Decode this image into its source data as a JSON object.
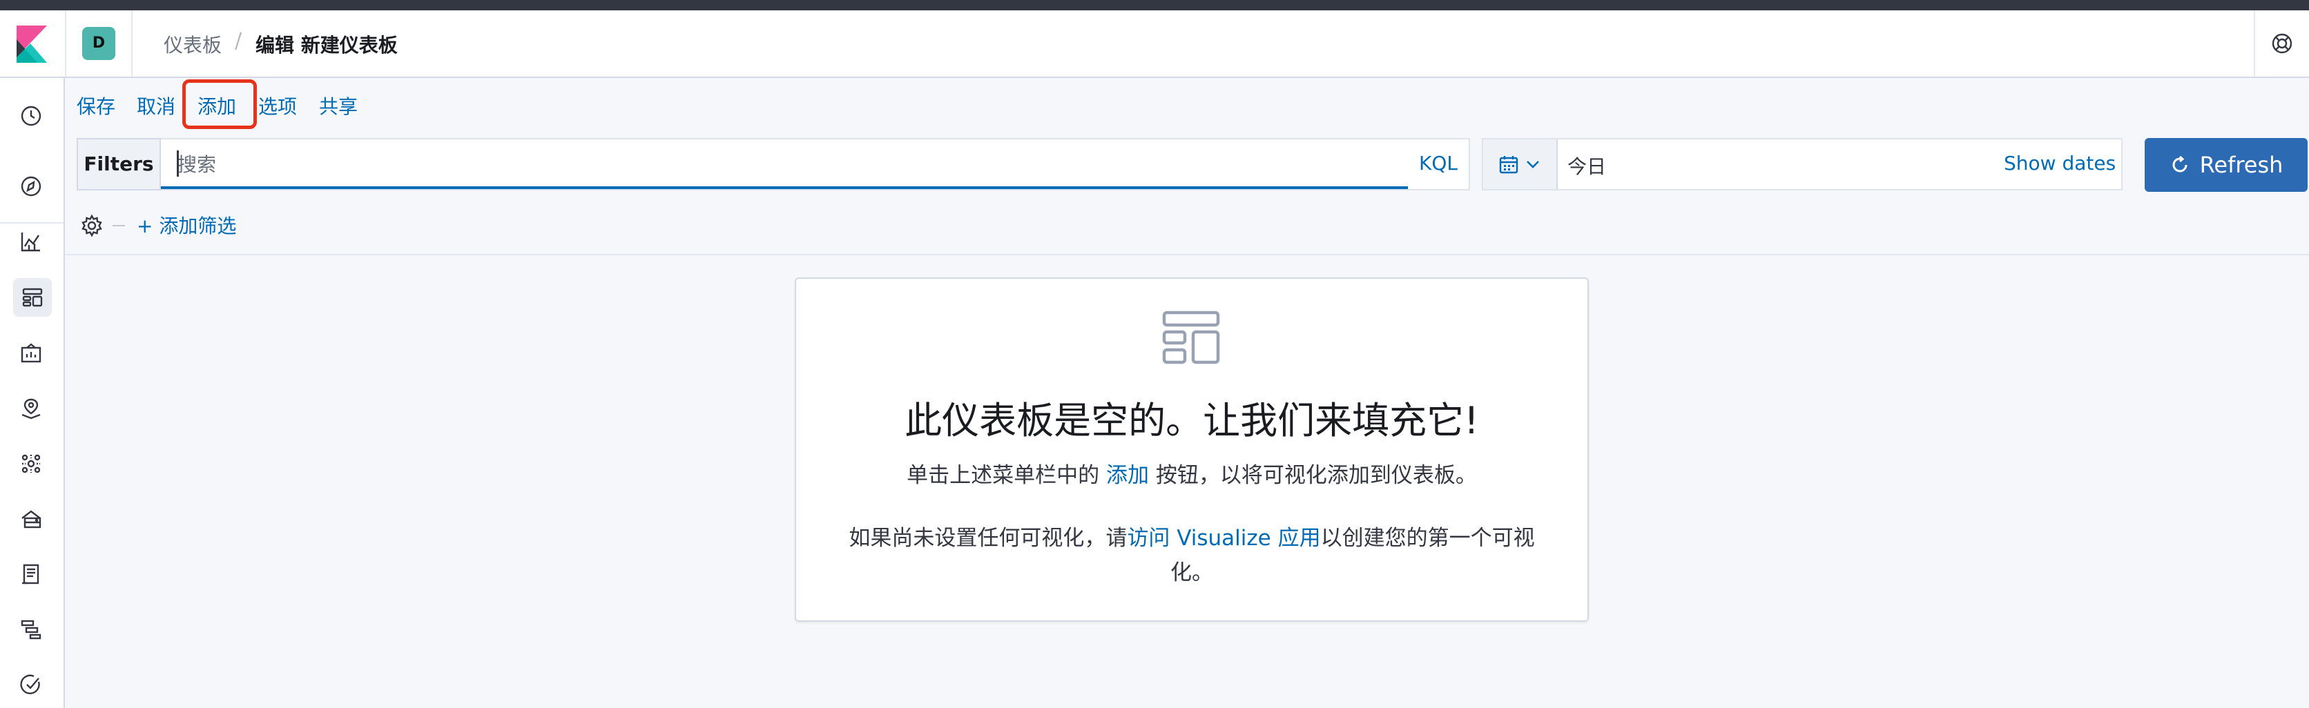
{
  "app": {
    "space_initial": "D",
    "breadcrumbs": [
      "仪表板",
      "编辑 新建仪表板"
    ],
    "breadcrumb_separator": "/"
  },
  "sidebar": {
    "items": [
      {
        "icon": "clock-icon"
      },
      {
        "icon": "discover-compass-icon"
      },
      {
        "icon": "visualize-chart-icon"
      },
      {
        "icon": "dashboard-icon",
        "active": true
      },
      {
        "icon": "canvas-icon"
      },
      {
        "icon": "maps-icon"
      },
      {
        "icon": "ml-icon"
      },
      {
        "icon": "infrastructure-icon"
      },
      {
        "icon": "logs-icon"
      },
      {
        "icon": "apm-icon"
      },
      {
        "icon": "uptime-icon"
      }
    ]
  },
  "top_menu": {
    "save": "保存",
    "cancel": "取消",
    "add": "添加",
    "options": "选项",
    "share": "共享"
  },
  "query_bar": {
    "filters_label": "Filters",
    "search_placeholder": "搜索",
    "search_value": "",
    "kql_label": "KQL",
    "date_value": "今日",
    "show_dates_label": "Show dates",
    "refresh_label": "Refresh"
  },
  "filter_row": {
    "add_filter_label": "+ 添加筛选"
  },
  "empty_state": {
    "title": "此仪表板是空的。让我们来填充它!",
    "line1_before": "单击上述菜单栏中的 ",
    "line1_link": "添加",
    "line1_after": " 按钮，以将可视化添加到仪表板。",
    "line2_before": "如果尚未设置任何可视化，请",
    "line2_link": "访问 Visualize 应用",
    "line2_after": "以创建您的第一个可视化。"
  },
  "colors": {
    "link": "#006bb4",
    "refresh_button": "#2d6ab4",
    "highlight_box": "#e7331b",
    "space_avatar": "#4fb6ad"
  }
}
